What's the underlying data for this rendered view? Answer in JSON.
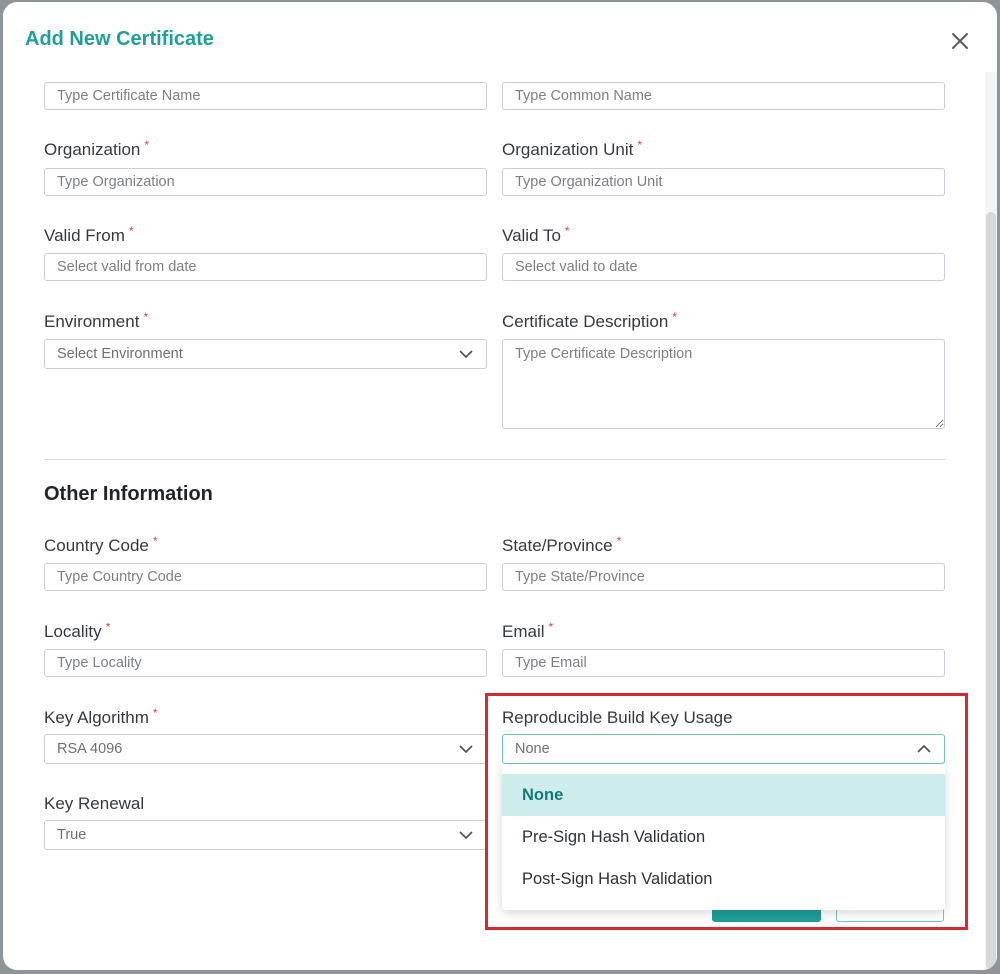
{
  "modal": {
    "title": "Add New Certificate",
    "accent_color": "#1f9f9a",
    "close_icon": "close-icon"
  },
  "fields": {
    "certificate_name": {
      "placeholder": "Type Certificate Name"
    },
    "common_name": {
      "placeholder": "Type Common Name"
    },
    "organization": {
      "label": "Organization",
      "required": "*",
      "placeholder": "Type Organization"
    },
    "organization_unit": {
      "label": "Organization Unit",
      "required": "*",
      "placeholder": "Type Organization Unit"
    },
    "valid_from": {
      "label": "Valid From",
      "required": "*",
      "placeholder": "Select valid from date"
    },
    "valid_to": {
      "label": "Valid To",
      "required": "*",
      "placeholder": "Select valid to date"
    },
    "environment": {
      "label": "Environment",
      "required": "*",
      "value": "Select Environment"
    },
    "certificate_description": {
      "label": "Certificate Description",
      "required": "*",
      "placeholder": "Type Certificate Description"
    }
  },
  "other_information": {
    "title": "Other Information",
    "country_code": {
      "label": "Country Code",
      "required": "*",
      "placeholder": "Type Country Code"
    },
    "state_province": {
      "label": "State/Province",
      "required": "*",
      "placeholder": "Type State/Province"
    },
    "locality": {
      "label": "Locality",
      "required": "*",
      "placeholder": "Type Locality"
    },
    "email": {
      "label": "Email",
      "required": "*",
      "placeholder": "Type Email"
    },
    "key_algorithm": {
      "label": "Key Algorithm",
      "required": "*",
      "value": "RSA 4096"
    },
    "reproducible_build_key_usage": {
      "label": "Reproducible Build Key Usage",
      "value": "None",
      "options": [
        "None",
        "Pre-Sign Hash Validation",
        "Post-Sign Hash Validation"
      ]
    },
    "key_renewal": {
      "label": "Key Renewal",
      "value": "True"
    }
  },
  "colors": {
    "required": "#e03b3b",
    "highlight": "#d42a2f",
    "selected_option_bg": "#cdecec"
  }
}
